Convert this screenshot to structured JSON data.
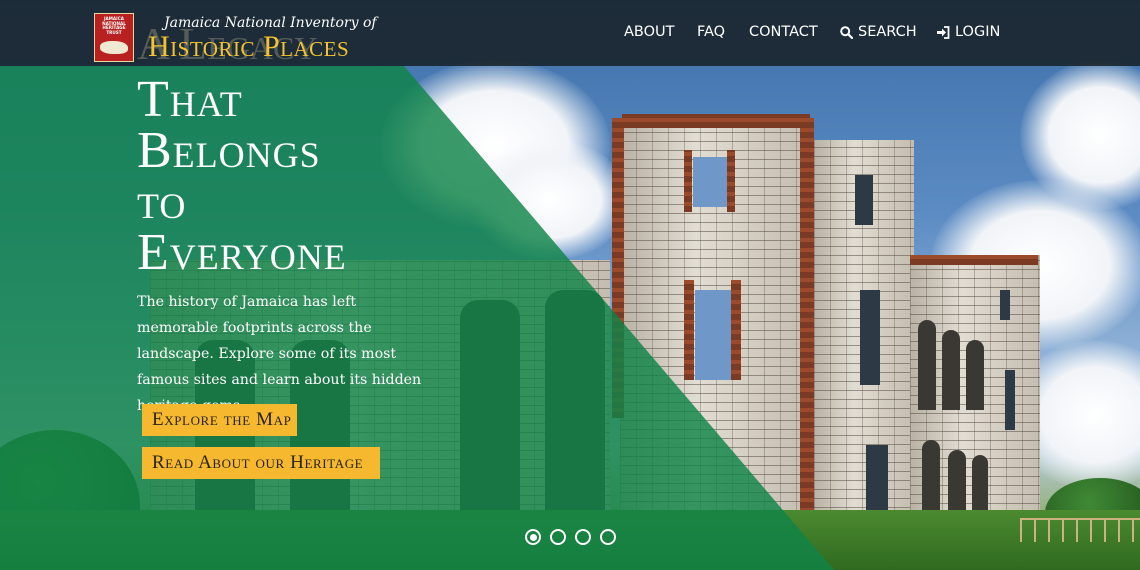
{
  "brand": {
    "logo_text": "JAMAICA NATIONAL HERITAGE TRUST",
    "subtitle": "Jamaica National Inventory of",
    "title": "Historic Places",
    "ghost_text": "A Legacy"
  },
  "nav": {
    "items": [
      {
        "label": "ABOUT"
      },
      {
        "label": "FAQ"
      },
      {
        "label": "CONTACT"
      },
      {
        "label": "SEARCH",
        "icon": "search-icon"
      },
      {
        "label": "LOGIN",
        "icon": "login-icon"
      }
    ]
  },
  "hero": {
    "headline": [
      "That",
      "Belongs",
      "to",
      "Everyone"
    ],
    "description": "The history of Jamaica has left memorable footprints across the landscape. Explore some of its most famous sites and learn about its hidden heritage gems..",
    "buttons": {
      "explore_map": "Explore the Map",
      "read_heritage": "Read About our Heritage"
    },
    "accent_color": "#f5b82e",
    "overlay_color": "#108448"
  },
  "carousel": {
    "slide_count": 4,
    "active_index": 0
  }
}
